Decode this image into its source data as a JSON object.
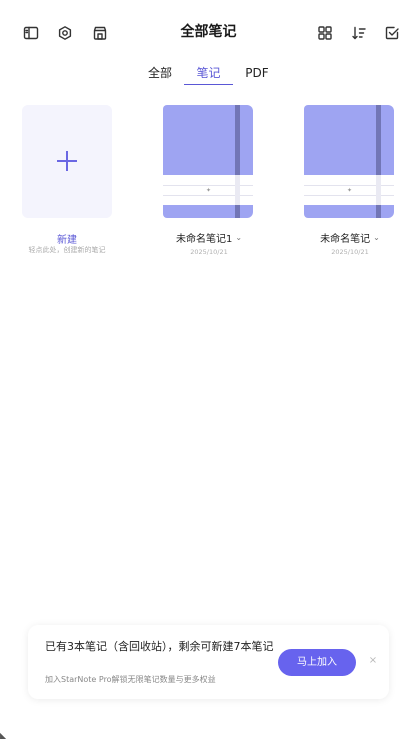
{
  "header": {
    "title": "全部笔记"
  },
  "tabs": [
    {
      "label": "全部"
    },
    {
      "label": "笔记"
    },
    {
      "label": "PDF"
    }
  ],
  "active_tab": "笔记",
  "new_item": {
    "label": "新建",
    "sub": "轻点此处，创建新的笔记"
  },
  "notebooks": [
    {
      "name": "未命名笔记1",
      "date": "2025/10/21"
    },
    {
      "name": "未命名笔记",
      "date": "2025/10/21"
    }
  ],
  "banner": {
    "text": "已有3本笔记（含回收站），剩余可新建7本笔记",
    "sub": "加入StarNote Pro解锁无限笔记数量与更多权益",
    "button_label": "马上加入",
    "close_glyph": "×"
  },
  "colors": {
    "accent": "#5a57d6",
    "button": "#6763ee",
    "notebook_cover": "#9ea4f2",
    "notebook_strap": "#7276b6",
    "new_card_bg": "#f4f4fd"
  },
  "icons": {
    "sidebar": "sidebar-toggle-icon",
    "settings": "settings-icon",
    "store": "store-icon",
    "grid": "grid-view-icon",
    "sort": "sort-icon",
    "select": "select-check-icon",
    "chevron": "chevron-down-icon"
  }
}
